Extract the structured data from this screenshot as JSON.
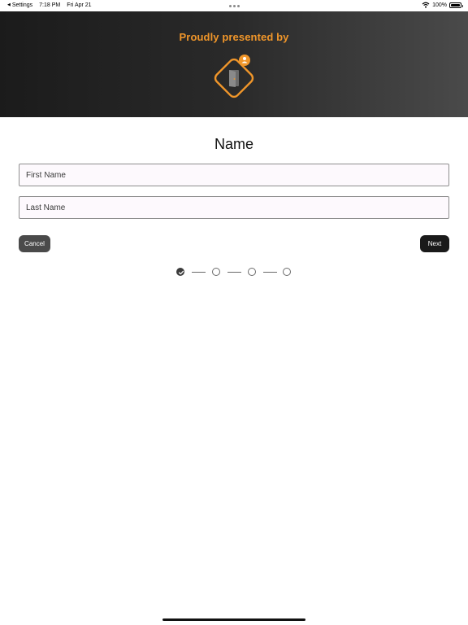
{
  "status_bar": {
    "back_label": "Settings",
    "time": "7:18 PM",
    "date": "Fri Apr 21",
    "battery": "100%",
    "battery_level": 1.0,
    "icons": [
      "back-arrow-icon",
      "multitask-dots-icon",
      "wifi-icon",
      "battery-icon"
    ]
  },
  "header": {
    "title": "Proudly presented by",
    "logo_icon": "door-logo-icon",
    "badge_icon": "person-badge-icon",
    "accent_color": "#f0962a"
  },
  "form": {
    "title": "Name",
    "first_name": {
      "value": "",
      "placeholder": "First Name"
    },
    "last_name": {
      "value": "",
      "placeholder": "Last Name"
    }
  },
  "actions": {
    "cancel_label": "Cancel",
    "next_label": "Next"
  },
  "stepper": {
    "total_steps": 4,
    "completed_steps": 1,
    "icons": [
      "check-icon"
    ]
  }
}
